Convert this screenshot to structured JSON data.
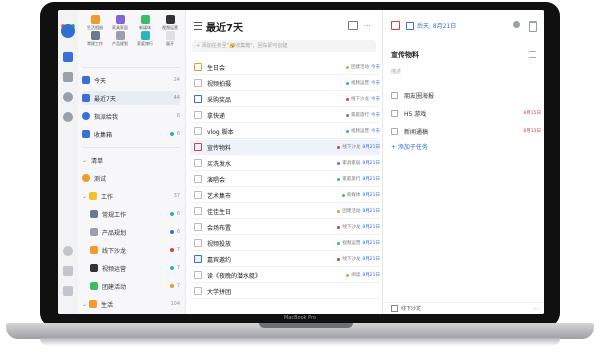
{
  "device": {
    "label": "MacBook Pro"
  },
  "colors": {
    "accent": "#3a6fd8",
    "red": "#d94040",
    "orange": "#f29a2e",
    "green": "#3dbb6b",
    "purple": "#8a63d2",
    "teal": "#2bb5b8"
  },
  "quick_launch": [
    {
      "label": "生活相册",
      "icon": "rainbow-icon"
    },
    {
      "label": "家具家居",
      "icon": "sofa-icon"
    },
    {
      "label": "新媒体",
      "icon": "tag-icon"
    },
    {
      "label": "视频运营",
      "icon": "clapper-icon"
    },
    {
      "label": "常规工作",
      "icon": "calendar-icon"
    },
    {
      "label": "产品规划",
      "icon": "laptop-icon"
    },
    {
      "label": "家庭旅行",
      "icon": "plane-icon"
    },
    {
      "label": "展开",
      "icon": "chevron-down-icon"
    }
  ],
  "smart_lists": [
    {
      "label": "今天",
      "count": "24"
    },
    {
      "label": "最近7天",
      "count": "44"
    },
    {
      "label": "指派给我",
      "count": "6"
    },
    {
      "label": "收集箱",
      "count": "6"
    }
  ],
  "groups": [
    {
      "label": "清单",
      "count": ""
    },
    {
      "label": "测试",
      "count": ""
    },
    {
      "label": "工作",
      "count": "37"
    },
    {
      "label": "常规工作",
      "count": "6"
    },
    {
      "label": "产品规划",
      "count": "6"
    },
    {
      "label": "线下沙龙",
      "count": "7"
    },
    {
      "label": "视频运营",
      "count": "7"
    },
    {
      "label": "团建活动",
      "count": "7"
    },
    {
      "label": "生活",
      "count": "104"
    }
  ],
  "list": {
    "title": "最近7天",
    "add_placeholder": "+ 添加任务至\"🥳收集箱\"，回车即可创建",
    "tasks": [
      {
        "title": "生日会",
        "list": "团建活动",
        "date": "今天",
        "red": false
      },
      {
        "title": "视频拍摄",
        "list": "视频运营",
        "date": "今天",
        "red": false
      },
      {
        "title": "采购奖品",
        "list": "线下沙龙",
        "date": "今天",
        "red": false
      },
      {
        "title": "拿快递",
        "list": "家庭旅行",
        "date": "今天",
        "red": false
      },
      {
        "title": "vlog 脚本",
        "list": "视频运营",
        "date": "今天",
        "red": false
      },
      {
        "title": "宣传物料",
        "list": "线下沙龙",
        "date": "8月21日",
        "red": false
      },
      {
        "title": "买洗发水",
        "list": "家具家居",
        "date": "8月21日",
        "red": false
      },
      {
        "title": "演唱会",
        "list": "家庭旅行",
        "date": "8月21日",
        "red": false
      },
      {
        "title": "艺术集市",
        "list": "新媒体",
        "date": "8月21日",
        "red": false
      },
      {
        "title": "佳佳生日",
        "list": "团建活动",
        "date": "8月21日",
        "red": false
      },
      {
        "title": "会场布置",
        "list": "线下沙龙",
        "date": "8月21日",
        "red": false
      },
      {
        "title": "视频投放",
        "list": "视频运营",
        "date": "8月21日",
        "red": false
      },
      {
        "title": "嘉宾邀约",
        "list": "线下沙龙",
        "date": "8月21日",
        "red": false
      },
      {
        "title": "读《夜晚的潜水艇》",
        "list": "阅读",
        "date": "8月21日",
        "red": false
      },
      {
        "title": "大学拼团",
        "list": "",
        "date": "",
        "red": false
      }
    ]
  },
  "detail": {
    "date_label": "后天, 8月21日",
    "title": "宣传物料",
    "description": "描述",
    "subtasks": [
      {
        "title": "朋友圈海报",
        "date": ""
      },
      {
        "title": "H5 游戏",
        "date": "8月15日"
      },
      {
        "title": "新闻通稿",
        "date": "8月13日"
      }
    ],
    "add_subtask": "+ 添加子任务",
    "footer_list": "线下沙龙"
  }
}
